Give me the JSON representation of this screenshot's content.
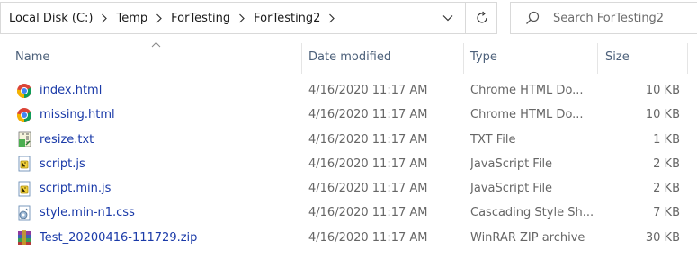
{
  "breadcrumb": {
    "items": [
      "Local Disk (C:)",
      "Temp",
      "ForTesting",
      "ForTesting2"
    ]
  },
  "search": {
    "placeholder": "Search ForTesting2",
    "value": ""
  },
  "columns": {
    "name": "Name",
    "date": "Date modified",
    "type": "Type",
    "size": "Size"
  },
  "files": [
    {
      "name": "index.html",
      "date": "4/16/2020 11:17 AM",
      "type": "Chrome HTML Do...",
      "size": "10 KB",
      "icon": "chrome-icon"
    },
    {
      "name": "missing.html",
      "date": "4/16/2020 11:17 AM",
      "type": "Chrome HTML Do...",
      "size": "10 KB",
      "icon": "chrome-icon"
    },
    {
      "name": "resize.txt",
      "date": "4/16/2020 11:17 AM",
      "type": "TXT File",
      "size": "1 KB",
      "icon": "text-file-icon"
    },
    {
      "name": "script.js",
      "date": "4/16/2020 11:17 AM",
      "type": "JavaScript File",
      "size": "2 KB",
      "icon": "js-file-icon"
    },
    {
      "name": "script.min.js",
      "date": "4/16/2020 11:17 AM",
      "type": "JavaScript File",
      "size": "2 KB",
      "icon": "js-file-icon"
    },
    {
      "name": "style.min-n1.css",
      "date": "4/16/2020 11:17 AM",
      "type": "Cascading Style Sh...",
      "size": "7 KB",
      "icon": "css-file-icon"
    },
    {
      "name": "Test_20200416-111729.zip",
      "date": "4/16/2020 11:17 AM",
      "type": "WinRAR ZIP archive",
      "size": "30 KB",
      "icon": "winrar-icon"
    }
  ],
  "colors": {
    "name_text": "#1a3aa8",
    "secondary_text": "#666666",
    "header_text": "#4c607a",
    "border": "#d9d9d9"
  }
}
